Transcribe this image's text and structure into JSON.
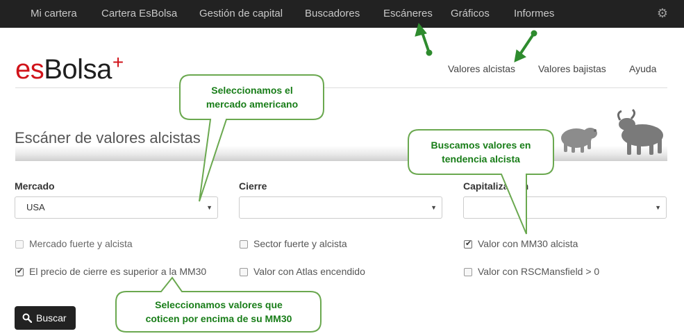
{
  "navbar": {
    "items": [
      "Mi cartera",
      "Cartera EsBolsa",
      "Gestión de capital",
      "Buscadores",
      "Escáneres",
      "Gráficos",
      "Informes"
    ],
    "settings_icon": "gear-icon"
  },
  "brand": {
    "part1": "es",
    "part2": "Bolsa",
    "plus": "+"
  },
  "subnav": {
    "items": [
      "Valores alcistas",
      "Valores bajistas",
      "Ayuda"
    ]
  },
  "page": {
    "title": "Escáner de valores alcistas"
  },
  "form": {
    "mercado": {
      "label": "Mercado",
      "value": "USA"
    },
    "cierre": {
      "label": "Cierre",
      "value": ""
    },
    "capitalizacion": {
      "label": "Capitalización",
      "value": ""
    },
    "checks": [
      {
        "label": "Mercado fuerte y alcista",
        "checked": false
      },
      {
        "label": "Sector fuerte y alcista",
        "checked": false
      },
      {
        "label": "Valor con MM30 alcista",
        "checked": true
      },
      {
        "label": "El precio de cierre es superior a la MM30",
        "checked": true
      },
      {
        "label": "Valor con Atlas encendido",
        "checked": false
      },
      {
        "label": "Valor con RSCMansfield > 0",
        "checked": false
      }
    ],
    "search_button": "Buscar",
    "search_icon": "search-icon"
  },
  "annotations": {
    "market": [
      "Seleccionamos el",
      "mercado americano"
    ],
    "trend": [
      "Buscamos valores en",
      "tendencia alcista"
    ],
    "mm30": [
      "Seleccionamos valores que",
      "coticen por encima de su MM30"
    ],
    "color": "#187d18"
  }
}
